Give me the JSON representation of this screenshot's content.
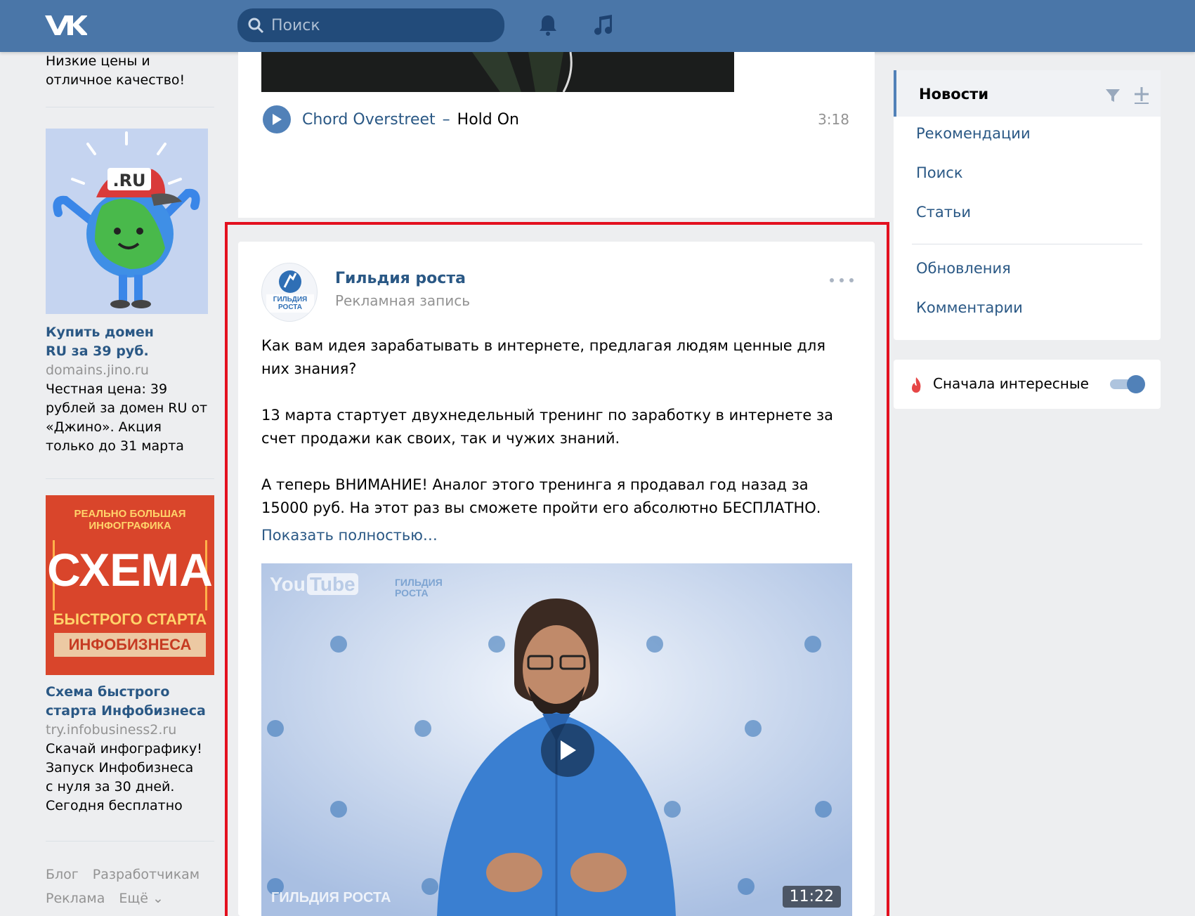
{
  "header": {
    "search_placeholder": "Поиск"
  },
  "left": {
    "ad0": {
      "text": "Низкие цены и отличное качество!"
    },
    "ad1": {
      "image_text": ".RU",
      "title": "Купить домен RU за 39 руб.",
      "domain": "domains.jino.ru",
      "description": "Честная цена: 39 рублей за домен RU от «Джино». Акция только до 31 марта"
    },
    "ad2": {
      "image_top": "РЕАЛЬНО БОЛЬШАЯ ИНФОГРАФИКА",
      "image_main": "СХЕМА",
      "image_line2": "БЫСТРОГО СТАРТА",
      "image_line3": "ИНФОБИЗНЕСА",
      "title": "Схема быстрого старта Инфобизнеса",
      "domain": "try.infobusiness2.ru",
      "description": "Скачай инфографику! Запуск Инфобизнеса с нуля за 30 дней. Сегодня бесплатно"
    },
    "footer": {
      "blog": "Блог",
      "developers": "Разработчикам",
      "ads": "Реклама",
      "more": "Ещё ⌄"
    }
  },
  "feed": {
    "track": {
      "artist": "Chord Overstreet",
      "dash": "–",
      "title": "Hold On",
      "duration": "3:18"
    },
    "post": {
      "author": "Гильдия роста",
      "subtitle": "Рекламная запись",
      "avatar_text": "ГИЛЬДИЯ РОСТА",
      "paragraphs": [
        "Как вам идея зарабатывать в интернете, предлагая людям ценные для них знания?",
        "13 марта стартует двухнедельный тренинг по заработку в интернете за счет продажи как своих, так и чужих знаний.",
        "А теперь ВНИМАНИЕ! Аналог этого тренинга я продавал год назад за 15000 руб. На этот раз вы сможете пройти его абсолютно БЕСПЛАТНО."
      ],
      "show_more": "Показать полностью…",
      "video": {
        "duration": "11:22",
        "yt_you": "You",
        "yt_tube": "Tube",
        "brand": "ГИЛЬДИЯ РОСТА",
        "backdrop_text": "ГИЛЬДИЯ РОСТА"
      }
    }
  },
  "right": {
    "menu": {
      "active": "Новости",
      "items": [
        "Рекомендации",
        "Поиск",
        "Статьи"
      ],
      "items2": [
        "Обновления",
        "Комментарии"
      ]
    },
    "toggle_label": "Сначала интересные"
  },
  "colors": {
    "header": "#4a76a8",
    "link": "#2a5885",
    "highlight_frame": "#e3101f",
    "page_bg": "#edeef0"
  }
}
